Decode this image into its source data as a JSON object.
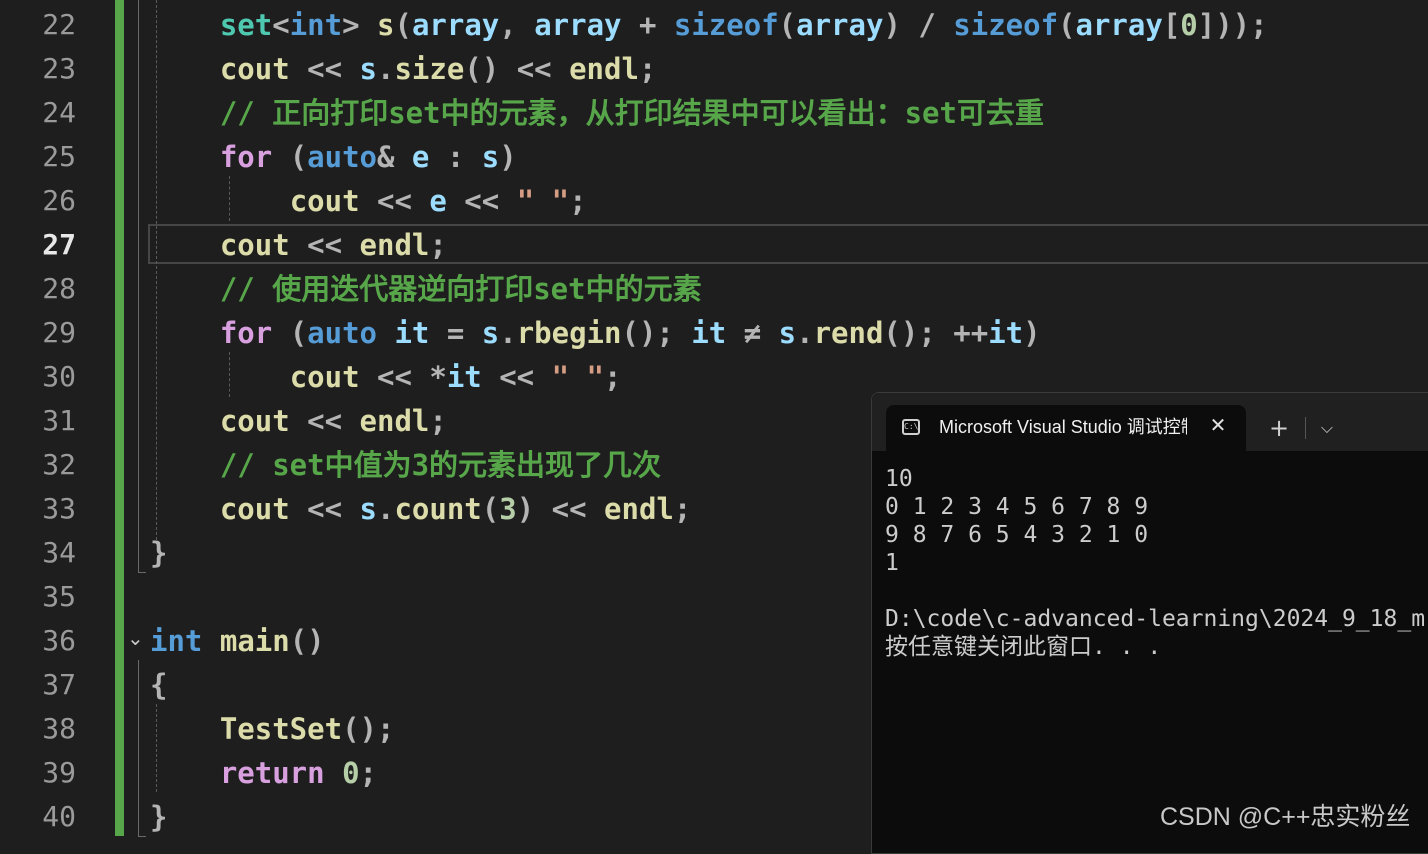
{
  "editor": {
    "active_line": "27",
    "lines": [
      {
        "n": "22",
        "indent": "    ",
        "tokens": [
          [
            "type",
            "set"
          ],
          [
            "op",
            "<"
          ],
          [
            "kw",
            "int"
          ],
          [
            "op",
            "> "
          ],
          [
            "fn",
            "s"
          ],
          [
            "op",
            "("
          ],
          [
            "var",
            "array"
          ],
          [
            "op",
            ", "
          ],
          [
            "var",
            "array"
          ],
          [
            "op",
            " + "
          ],
          [
            "kw",
            "sizeof"
          ],
          [
            "op",
            "("
          ],
          [
            "var",
            "array"
          ],
          [
            "op",
            ") / "
          ],
          [
            "kw",
            "sizeof"
          ],
          [
            "op",
            "("
          ],
          [
            "var",
            "array"
          ],
          [
            "op",
            "["
          ],
          [
            "num",
            "0"
          ],
          [
            "op",
            "]));"
          ]
        ]
      },
      {
        "n": "23",
        "indent": "    ",
        "tokens": [
          [
            "fn",
            "cout"
          ],
          [
            "op",
            " << "
          ],
          [
            "var",
            "s"
          ],
          [
            "op",
            "."
          ],
          [
            "fn",
            "size"
          ],
          [
            "op",
            "() << "
          ],
          [
            "fn",
            "endl"
          ],
          [
            "op",
            ";"
          ]
        ]
      },
      {
        "n": "24",
        "indent": "    ",
        "tokens": [
          [
            "cm",
            "// 正向打印set中的元素，从打印结果中可以看出：set可去重"
          ]
        ]
      },
      {
        "n": "25",
        "indent": "    ",
        "tokens": [
          [
            "ctrl",
            "for"
          ],
          [
            "op",
            " ("
          ],
          [
            "kw",
            "auto"
          ],
          [
            "op",
            "& "
          ],
          [
            "var",
            "e"
          ],
          [
            "op",
            " : "
          ],
          [
            "var",
            "s"
          ],
          [
            "op",
            ")"
          ]
        ]
      },
      {
        "n": "26",
        "indent": "        ",
        "tokens": [
          [
            "fn",
            "cout"
          ],
          [
            "op",
            " << "
          ],
          [
            "var",
            "e"
          ],
          [
            "op",
            " << "
          ],
          [
            "str",
            "\" \""
          ],
          [
            "op",
            ";"
          ]
        ]
      },
      {
        "n": "27",
        "indent": "    ",
        "tokens": [
          [
            "fn",
            "cout"
          ],
          [
            "op",
            " << "
          ],
          [
            "fn",
            "endl"
          ],
          [
            "op",
            ";"
          ]
        ]
      },
      {
        "n": "28",
        "indent": "    ",
        "tokens": [
          [
            "cm",
            "// 使用迭代器逆向打印set中的元素"
          ]
        ]
      },
      {
        "n": "29",
        "indent": "    ",
        "tokens": [
          [
            "ctrl",
            "for"
          ],
          [
            "op",
            " ("
          ],
          [
            "kw",
            "auto"
          ],
          [
            "op",
            " "
          ],
          [
            "var",
            "it"
          ],
          [
            "op",
            " = "
          ],
          [
            "var",
            "s"
          ],
          [
            "op",
            "."
          ],
          [
            "fn",
            "rbegin"
          ],
          [
            "op",
            "(); "
          ],
          [
            "var",
            "it"
          ],
          [
            "op",
            " ≠ "
          ],
          [
            "var",
            "s"
          ],
          [
            "op",
            "."
          ],
          [
            "fn",
            "rend"
          ],
          [
            "op",
            "(); ++"
          ],
          [
            "var",
            "it"
          ],
          [
            "op",
            ")"
          ]
        ]
      },
      {
        "n": "30",
        "indent": "        ",
        "tokens": [
          [
            "fn",
            "cout"
          ],
          [
            "op",
            " << *"
          ],
          [
            "var",
            "it"
          ],
          [
            "op",
            " << "
          ],
          [
            "str",
            "\" \""
          ],
          [
            "op",
            ";"
          ]
        ]
      },
      {
        "n": "31",
        "indent": "    ",
        "tokens": [
          [
            "fn",
            "cout"
          ],
          [
            "op",
            " << "
          ],
          [
            "fn",
            "endl"
          ],
          [
            "op",
            ";"
          ]
        ]
      },
      {
        "n": "32",
        "indent": "    ",
        "tokens": [
          [
            "cm",
            "// set中值为3的元素出现了几次"
          ]
        ]
      },
      {
        "n": "33",
        "indent": "    ",
        "tokens": [
          [
            "fn",
            "cout"
          ],
          [
            "op",
            " << "
          ],
          [
            "var",
            "s"
          ],
          [
            "op",
            "."
          ],
          [
            "fn",
            "count"
          ],
          [
            "op",
            "("
          ],
          [
            "num",
            "3"
          ],
          [
            "op",
            ") << "
          ],
          [
            "fn",
            "endl"
          ],
          [
            "op",
            ";"
          ]
        ]
      },
      {
        "n": "34",
        "indent": "",
        "tokens": [
          [
            "op",
            "}"
          ]
        ]
      },
      {
        "n": "35",
        "indent": "",
        "tokens": []
      },
      {
        "n": "36",
        "indent": "",
        "tokens": [
          [
            "kw",
            "int"
          ],
          [
            "op",
            " "
          ],
          [
            "fn",
            "main"
          ],
          [
            "op",
            "()"
          ]
        ]
      },
      {
        "n": "37",
        "indent": "",
        "tokens": [
          [
            "op",
            "{"
          ]
        ]
      },
      {
        "n": "38",
        "indent": "    ",
        "tokens": [
          [
            "fn",
            "TestSet"
          ],
          [
            "op",
            "();"
          ]
        ]
      },
      {
        "n": "39",
        "indent": "    ",
        "tokens": [
          [
            "ctrl",
            "return"
          ],
          [
            "op",
            " "
          ],
          [
            "num",
            "0"
          ],
          [
            "op",
            ";"
          ]
        ]
      },
      {
        "n": "40",
        "indent": "",
        "tokens": [
          [
            "op",
            "}"
          ]
        ]
      }
    ]
  },
  "console": {
    "tab_title": "Microsoft Visual Studio 调试控制台",
    "tab_icon_text": "C:\\",
    "close_glyph": "✕",
    "new_tab_glyph": "+",
    "dropdown_glyph": "⌵",
    "output": [
      "10",
      "0 1 2 3 4 5 6 7 8 9",
      "9 8 7 6 5 4 3 2 1 0",
      "1",
      "",
      "D:\\code\\c-advanced-learning\\2024_9_18_m",
      "按任意键关闭此窗口. . ."
    ]
  },
  "watermark": "CSDN @C++忠实粉丝",
  "colors": {
    "background": "#1e1e1e",
    "change_bar": "#57a64a",
    "comment": "#57a64a",
    "keyword": "#569cd6",
    "control": "#d8a0df",
    "function": "#dcdcaa",
    "variable": "#9cdcfe",
    "type": "#4ec9b0",
    "console_bg": "#0c0c0c"
  }
}
